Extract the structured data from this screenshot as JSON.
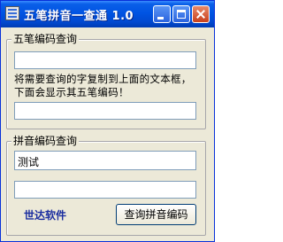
{
  "window": {
    "title": "五笔拼音一查通 1.0",
    "controls": {
      "minimize": "minimize-icon",
      "maximize": "maximize-icon",
      "close": "close-icon"
    }
  },
  "wubi": {
    "legend": "五笔编码查询",
    "input_value": "",
    "instruction": "将需要查询的字复制到上面的文本框，下面会显示其五笔编码！",
    "output_value": ""
  },
  "pinyin": {
    "legend": "拼音编码查询",
    "input_value": "测试",
    "output_value": "",
    "query_button": "查询拼音编码"
  },
  "brand": "世达软件",
  "colors": {
    "titlebar": "#0054e3",
    "window_bg": "#ece9d8",
    "brand_text": "#1b2ea0",
    "field_border": "#7f9db9"
  }
}
